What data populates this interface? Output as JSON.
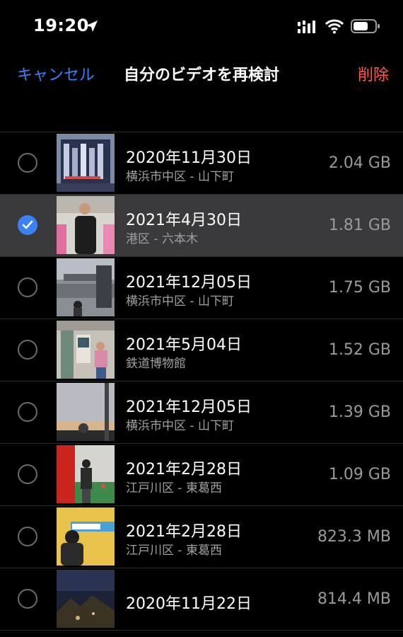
{
  "status": {
    "time": "19:20"
  },
  "nav": {
    "cancel": "キャンセル",
    "title": "自分のビデオを再検討",
    "delete": "削除"
  },
  "colors": {
    "accent": "#3b82f6",
    "destructive": "#ff5b4f",
    "background": "#000000",
    "selected_row": "#3a3a3c"
  },
  "videos": [
    {
      "date": "2020年11月30日",
      "place": "横浜市中区 - 山下町",
      "size": "2.04 GB",
      "selected": false
    },
    {
      "date": "2021年4月30日",
      "place": "港区 - 六本木",
      "size": "1.81 GB",
      "selected": true
    },
    {
      "date": "2021年12月05日",
      "place": "横浜市中区 - 山下町",
      "size": "1.75 GB",
      "selected": false
    },
    {
      "date": "2021年5月04日",
      "place": "鉄道博物館",
      "size": "1.52 GB",
      "selected": false
    },
    {
      "date": "2021年12月05日",
      "place": "横浜市中区 - 山下町",
      "size": "1.39 GB",
      "selected": false
    },
    {
      "date": "2021年2月28日",
      "place": "江戸川区 - 東葛西",
      "size": "1.09 GB",
      "selected": false
    },
    {
      "date": "2021年2月28日",
      "place": "江戸川区 - 東葛西",
      "size": "823.3 MB",
      "selected": false
    },
    {
      "date": "2020年11月22日",
      "place": "",
      "size": "814.4 MB",
      "selected": false
    }
  ]
}
